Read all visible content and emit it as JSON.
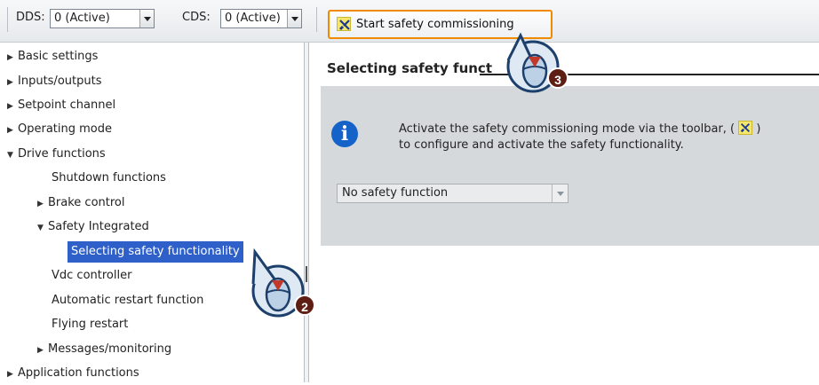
{
  "toolbar": {
    "dds_label": "DDS:",
    "dds_value": "0 (Active)",
    "cds_label": "CDS:",
    "cds_value": "0 (Active)",
    "start_button_label": "Start safety commissioning",
    "start_button_icon": "safety-tool-icon"
  },
  "tree": {
    "items": [
      {
        "label": "Basic settings",
        "state": "collapsed"
      },
      {
        "label": "Inputs/outputs",
        "state": "collapsed"
      },
      {
        "label": "Setpoint channel",
        "state": "collapsed"
      },
      {
        "label": "Operating mode",
        "state": "collapsed"
      },
      {
        "label": "Drive functions",
        "state": "expanded"
      },
      {
        "label": "Shutdown functions",
        "state": "leaf"
      },
      {
        "label": "Brake control",
        "state": "collapsed"
      },
      {
        "label": "Safety Integrated",
        "state": "expanded"
      },
      {
        "label": "Selecting safety functionality",
        "state": "selected"
      },
      {
        "label": "Vdc controller",
        "state": "leaf"
      },
      {
        "label": "Automatic restart function",
        "state": "leaf"
      },
      {
        "label": "Flying restart",
        "state": "leaf"
      },
      {
        "label": "Messages/monitoring",
        "state": "collapsed"
      },
      {
        "label": "Application functions",
        "state": "collapsed"
      }
    ],
    "selection_color": "#2f5fc9"
  },
  "content": {
    "section_title": "Selecting safety funct",
    "info_line1": "Activate the safety commissioning mode via the toolbar, (",
    "info_line1_end": ")",
    "info_line2": "to configure and activate the safety functionality.",
    "info_icon": "info-icon",
    "dropdown_value": "No safety function"
  },
  "callouts": [
    {
      "number": "2",
      "target": "Selecting safety functionality"
    },
    {
      "number": "3",
      "target": "Start safety commissioning"
    }
  ],
  "colors": {
    "highlight_border": "#f08a00",
    "badge": "#5e1e14",
    "info_blue": "#1563c9",
    "panel_gray": "#d6d9dc"
  }
}
